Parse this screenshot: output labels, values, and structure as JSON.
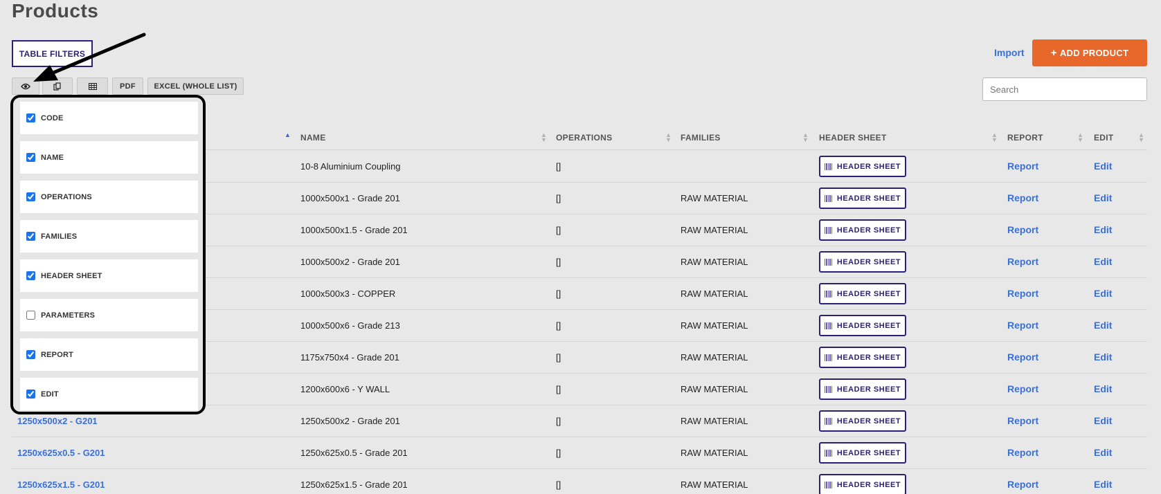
{
  "page": {
    "title": "Products"
  },
  "toolbar": {
    "filters_label": "TABLE FILTERS",
    "import_label": "Import",
    "add_label": "ADD PRODUCT",
    "add_icon": "+",
    "pdf_label": "PDF",
    "excel_label": "EXCEL (WHOLE LIST)",
    "search_placeholder": "Search",
    "colors": {
      "accent": "#e8672a",
      "brand": "#2a1f7a",
      "link": "#3a6fd8"
    }
  },
  "columns_panel": {
    "items": [
      {
        "label": "CODE",
        "checked": true
      },
      {
        "label": "NAME",
        "checked": true
      },
      {
        "label": "OPERATIONS",
        "checked": true
      },
      {
        "label": "FAMILIES",
        "checked": true
      },
      {
        "label": "HEADER SHEET",
        "checked": true
      },
      {
        "label": "PARAMETERS",
        "checked": false
      },
      {
        "label": "REPORT",
        "checked": true
      },
      {
        "label": "EDIT",
        "checked": true
      }
    ]
  },
  "table": {
    "headers": {
      "name": "NAME",
      "operations": "OPERATIONS",
      "families": "FAMILIES",
      "header_sheet": "HEADER SHEET",
      "report": "REPORT",
      "edit": "EDIT"
    },
    "header_sheet_label": "HEADER SHEET",
    "report_label": "Report",
    "edit_label": "Edit",
    "rows": [
      {
        "code": "",
        "name": "10-8 Aluminium Coupling",
        "operations": "[]",
        "families": ""
      },
      {
        "code": "",
        "name": "1000x500x1 - Grade 201",
        "operations": "[]",
        "families": "RAW MATERIAL"
      },
      {
        "code": "",
        "name": "1000x500x1.5 - Grade 201",
        "operations": "[]",
        "families": "RAW MATERIAL"
      },
      {
        "code": "",
        "name": "1000x500x2 - Grade 201",
        "operations": "[]",
        "families": "RAW MATERIAL"
      },
      {
        "code": "",
        "name": "1000x500x3 - COPPER",
        "operations": "[]",
        "families": "RAW MATERIAL"
      },
      {
        "code": "",
        "name": "1000x500x6 - Grade 213",
        "operations": "[]",
        "families": "RAW MATERIAL"
      },
      {
        "code": "",
        "name": "1175x750x4 - Grade 201",
        "operations": "[]",
        "families": "RAW MATERIAL"
      },
      {
        "code": "",
        "name": "1200x600x6 - Y WALL",
        "operations": "[]",
        "families": "RAW MATERIAL"
      },
      {
        "code": "1250x500x2 - G201",
        "name": "1250x500x2 - Grade 201",
        "operations": "[]",
        "families": "RAW MATERIAL"
      },
      {
        "code": "1250x625x0.5 - G201",
        "name": "1250x625x0.5 - Grade 201",
        "operations": "[]",
        "families": "RAW MATERIAL"
      },
      {
        "code": "1250x625x1.5 - G201",
        "name": "1250x625x1.5 - Grade 201",
        "operations": "[]",
        "families": "RAW MATERIAL"
      }
    ]
  }
}
